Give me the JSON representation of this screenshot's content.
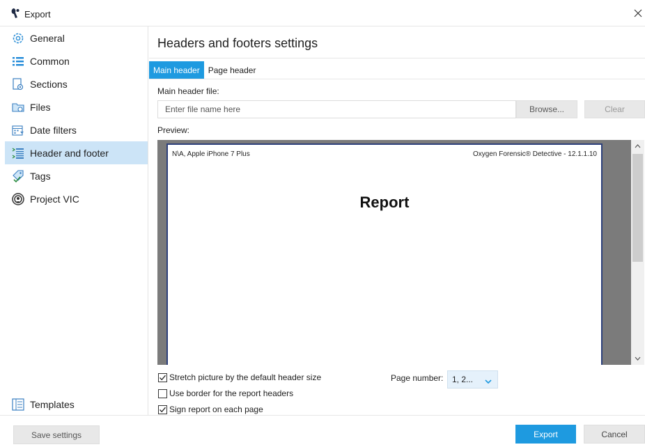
{
  "window": {
    "title": "Export",
    "close_icon": "close-icon",
    "app_icon": "oxygen-icon"
  },
  "colors": {
    "accent": "#1e9ae0",
    "active_item_bg": "#cce4f7",
    "preview_bg": "#7b7b7b"
  },
  "sidebar": {
    "items": [
      {
        "label": "General",
        "icon": "gear-icon"
      },
      {
        "label": "Common",
        "icon": "list-icon"
      },
      {
        "label": "Sections",
        "icon": "sections-icon"
      },
      {
        "label": "Files",
        "icon": "files-icon"
      },
      {
        "label": "Date filters",
        "icon": "calendar-icon"
      },
      {
        "label": "Header and footer",
        "icon": "header-footer-icon",
        "active": true
      },
      {
        "label": "Tags",
        "icon": "tag-icon"
      },
      {
        "label": "Project VIC",
        "icon": "project-vic-icon"
      }
    ],
    "templates": {
      "label": "Templates",
      "icon": "templates-icon"
    }
  },
  "main": {
    "heading": "Headers and footers settings",
    "tabs": [
      {
        "label": "Main header",
        "active": true
      },
      {
        "label": "Page header",
        "active": false
      }
    ],
    "file_label": "Main header file:",
    "file_input": {
      "value": "",
      "placeholder": "Enter file name here"
    },
    "browse_label": "Browse...",
    "clear_label": "Clear",
    "preview_label": "Preview:",
    "preview": {
      "header_left": "N\\A, Apple iPhone 7 Plus",
      "header_right": "Oxygen Forensic® Detective - 12.1.1.10",
      "title": "Report"
    },
    "options": [
      {
        "label": "Stretch picture by the default header size",
        "checked": true
      },
      {
        "label": "Use border for the report headers",
        "checked": false
      },
      {
        "label": "Sign report on each page",
        "checked": true
      }
    ],
    "page_number": {
      "label": "Page number:",
      "value": "1, 2..."
    }
  },
  "footer": {
    "save_label": "Save settings",
    "export_label": "Export",
    "cancel_label": "Cancel"
  }
}
